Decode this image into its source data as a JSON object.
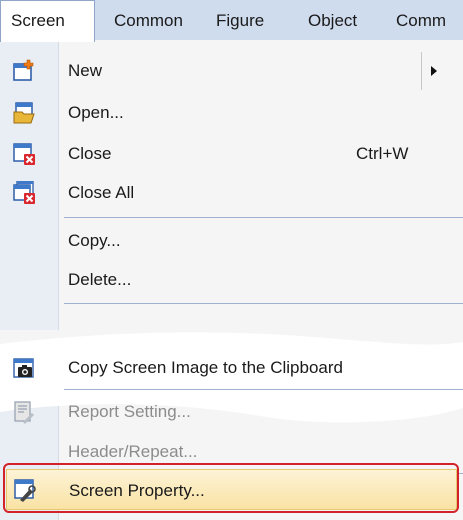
{
  "menubar": {
    "items": [
      "Screen",
      "Common",
      "Figure",
      "Object",
      "Comm"
    ]
  },
  "menu": {
    "new": "New",
    "open": "Open...",
    "close": "Close",
    "close_shortcut": "Ctrl+W",
    "close_all": "Close All",
    "copy": "Copy...",
    "delete": "Delete...",
    "copy_image": "Copy Screen Image to the Clipboard",
    "report_setting": "Report Setting...",
    "header_repeat": "Header/Repeat...",
    "screen_property": "Screen Property..."
  },
  "colors": {
    "highlight_border": "#d2232a",
    "highlight_fill": "#f9e2a4",
    "menubar_bg": "#cfdcee"
  },
  "icons": {
    "new": "new-screen-icon",
    "open": "open-screen-icon",
    "close": "close-screen-icon",
    "close_all": "close-all-icon",
    "copy_image": "camera-icon",
    "report_setting": "report-setting-icon",
    "screen_property": "screen-property-icon"
  }
}
